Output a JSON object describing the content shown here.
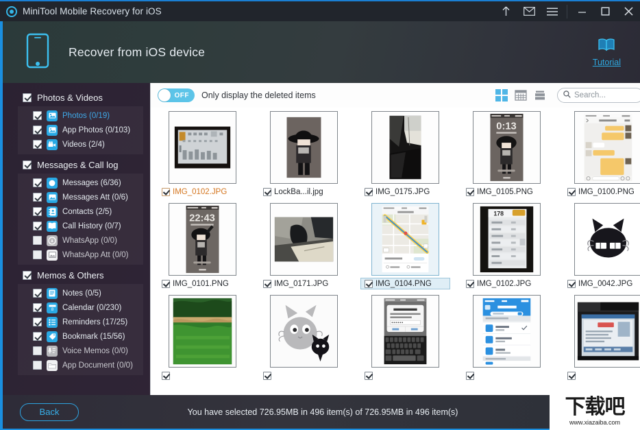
{
  "window": {
    "title": "MiniTool Mobile Recovery for iOS",
    "logo_icon": "target-circle-icon",
    "controls": [
      {
        "name": "upload-icon",
        "glyph": "↑"
      },
      {
        "name": "mail-icon",
        "glyph": "✉"
      },
      {
        "name": "menu-icon",
        "glyph": "☰"
      },
      {
        "name": "minimize-icon",
        "glyph": "–"
      },
      {
        "name": "maximize-icon",
        "glyph": "□"
      },
      {
        "name": "close-icon",
        "glyph": "✕"
      }
    ]
  },
  "header": {
    "device_icon": "iphone-icon",
    "title": "Recover from iOS device",
    "tutorial_icon": "open-book-icon",
    "tutorial_label": "Tutorial"
  },
  "sidebar": {
    "groups": [
      {
        "label": "Photos & Videos",
        "checked": true,
        "items": [
          {
            "label": "Photos (0/19)",
            "icon": "photo-icon",
            "checked": true,
            "active": true,
            "enabled": true
          },
          {
            "label": "App Photos (0/103)",
            "icon": "app-photo-icon",
            "checked": true,
            "active": false,
            "enabled": true
          },
          {
            "label": "Videos (2/4)",
            "icon": "video-camera-icon",
            "checked": true,
            "active": false,
            "enabled": true
          }
        ]
      },
      {
        "label": "Messages & Call log",
        "checked": true,
        "items": [
          {
            "label": "Messages (6/36)",
            "icon": "message-bubble-icon",
            "checked": true,
            "active": false,
            "enabled": true
          },
          {
            "label": "Messages Att (0/6)",
            "icon": "attachment-image-icon",
            "checked": true,
            "active": false,
            "enabled": true
          },
          {
            "label": "Contacts (2/5)",
            "icon": "contacts-book-icon",
            "checked": true,
            "active": false,
            "enabled": true
          },
          {
            "label": "Call History (0/7)",
            "icon": "call-history-icon",
            "checked": true,
            "active": false,
            "enabled": true
          },
          {
            "label": "WhatsApp (0/0)",
            "icon": "whatsapp-icon",
            "checked": false,
            "active": false,
            "enabled": false
          },
          {
            "label": "WhatsApp Att (0/0)",
            "icon": "whatsapp-attachment-icon",
            "checked": false,
            "active": false,
            "enabled": false
          }
        ]
      },
      {
        "label": "Memos & Others",
        "checked": true,
        "items": [
          {
            "label": "Notes (0/5)",
            "icon": "notes-icon",
            "checked": true,
            "active": false,
            "enabled": true
          },
          {
            "label": "Calendar (0/230)",
            "icon": "calendar-icon",
            "checked": true,
            "active": false,
            "enabled": true
          },
          {
            "label": "Reminders (17/25)",
            "icon": "reminders-list-icon",
            "checked": true,
            "active": false,
            "enabled": true
          },
          {
            "label": "Bookmark (15/56)",
            "icon": "bookmark-tag-icon",
            "checked": true,
            "active": false,
            "enabled": true
          },
          {
            "label": "Voice Memos (0/0)",
            "icon": "voice-memo-icon",
            "checked": false,
            "active": false,
            "enabled": false
          },
          {
            "label": "App Document (0/0)",
            "icon": "folder-icon",
            "checked": false,
            "active": false,
            "enabled": false
          }
        ]
      }
    ]
  },
  "toolbar": {
    "toggle_state": "OFF",
    "toggle_caption": "Only display the deleted items",
    "view_modes": [
      {
        "name": "grid-view-icon",
        "active": true
      },
      {
        "name": "calendar-view-icon",
        "active": false
      },
      {
        "name": "list-view-icon",
        "active": false
      }
    ],
    "search_icon": "search-icon",
    "search_placeholder": "Search...",
    "search_value": ""
  },
  "grid": {
    "items": [
      {
        "label": "IMG_0102.JPG",
        "checked": true,
        "selected": false,
        "deleted": true,
        "thumb": "photo-keyboard-dark"
      },
      {
        "label": "LockBa...il.jpg",
        "checked": true,
        "selected": false,
        "deleted": false,
        "thumb": "cartoon-hat-boy"
      },
      {
        "label": "IMG_0175.JPG",
        "checked": true,
        "selected": false,
        "deleted": false,
        "thumb": "photo-dark-cloth"
      },
      {
        "label": "IMG_0105.PNG",
        "checked": true,
        "selected": false,
        "deleted": false,
        "thumb": "lockscreen-0113"
      },
      {
        "label": "IMG_0100.PNG",
        "checked": true,
        "selected": false,
        "deleted": false,
        "thumb": "chat-screenshot"
      },
      {
        "label": "IMG_0101.PNG",
        "checked": true,
        "selected": false,
        "deleted": false,
        "thumb": "lockscreen-2243"
      },
      {
        "label": "IMG_0171.JPG",
        "checked": true,
        "selected": false,
        "deleted": false,
        "thumb": "photo-desk-dark"
      },
      {
        "label": "IMG_0104.PNG",
        "checked": true,
        "selected": true,
        "deleted": false,
        "thumb": "map-route-screenshot"
      },
      {
        "label": "IMG_0102.JPG",
        "checked": true,
        "selected": false,
        "deleted": false,
        "thumb": "photo-list-screen"
      },
      {
        "label": "IMG_0042.JPG",
        "checked": true,
        "selected": false,
        "deleted": false,
        "thumb": "black-cat-face"
      },
      {
        "label": "",
        "checked": true,
        "selected": false,
        "deleted": false,
        "thumb": "lake-forest-photo"
      },
      {
        "label": "",
        "checked": true,
        "selected": false,
        "deleted": false,
        "thumb": "grey-cat-cartoon"
      },
      {
        "label": "",
        "checked": true,
        "selected": false,
        "deleted": false,
        "thumb": "keyboard-dialog-screen"
      },
      {
        "label": "",
        "checked": true,
        "selected": false,
        "deleted": false,
        "thumb": "wifi-list-screen"
      },
      {
        "label": "",
        "checked": true,
        "selected": false,
        "deleted": false,
        "thumb": "monitor-photo"
      }
    ]
  },
  "footer": {
    "back_label": "Back",
    "status": "You have selected 726.95MB in 496 item(s) of 726.95MB in 496 item(s)"
  },
  "watermark": {
    "cn": "下载吧",
    "url": "www.xiazaiba.com"
  },
  "colors": {
    "accent_blue": "#1a8fe0",
    "cyan": "#35b6e8",
    "deleted_orange": "#d4751e",
    "selection_blue": "#7fb4d0"
  }
}
